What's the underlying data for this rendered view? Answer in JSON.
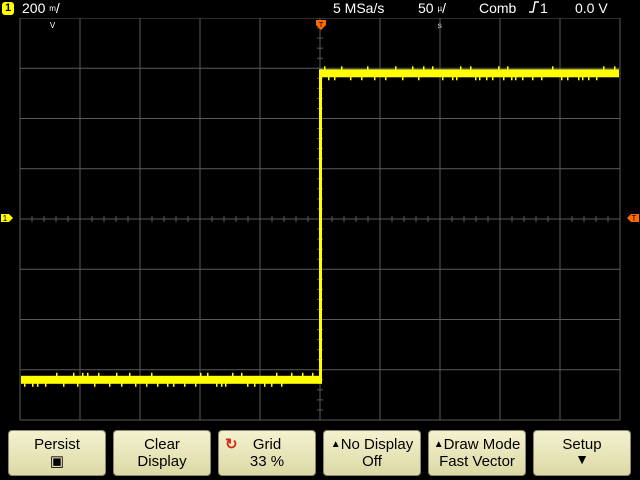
{
  "status": {
    "channel_num": "1",
    "channel_scale": "200",
    "channel_unit_top": "m",
    "channel_unit_bottom": "V",
    "sample_rate": "5 MSa/s",
    "timebase": "50",
    "time_unit_top": "µ",
    "time_unit_bottom": "s",
    "trigger_mode": "Comb",
    "trigger_edge_icon": "rising-edge-icon",
    "trigger_source": "1",
    "trigger_level": "0.0 V"
  },
  "markers": {
    "ground_marker": "1",
    "trigger_level_marker": "T",
    "trigger_position_marker": "T"
  },
  "waveform": {
    "color": "#ffff00",
    "low_level_div": -3.2,
    "high_level_div": 2.9,
    "step_time_div": 0
  },
  "softkeys": [
    {
      "line1": "Persist",
      "line2": "▣"
    },
    {
      "line1": "Clear",
      "line2": "Display"
    },
    {
      "line1": "Grid",
      "line2": "33 %"
    },
    {
      "line1": "No Display",
      "line2": "Off"
    },
    {
      "line1": "Draw Mode",
      "line2": "Fast Vector"
    },
    {
      "line1": "Setup",
      "line2": ""
    }
  ],
  "colors": {
    "grid": "#5a5a5a",
    "softkey_bg": "#efedc0",
    "channel1": "#ffff00",
    "trigger_marker": "#ff6a00"
  }
}
